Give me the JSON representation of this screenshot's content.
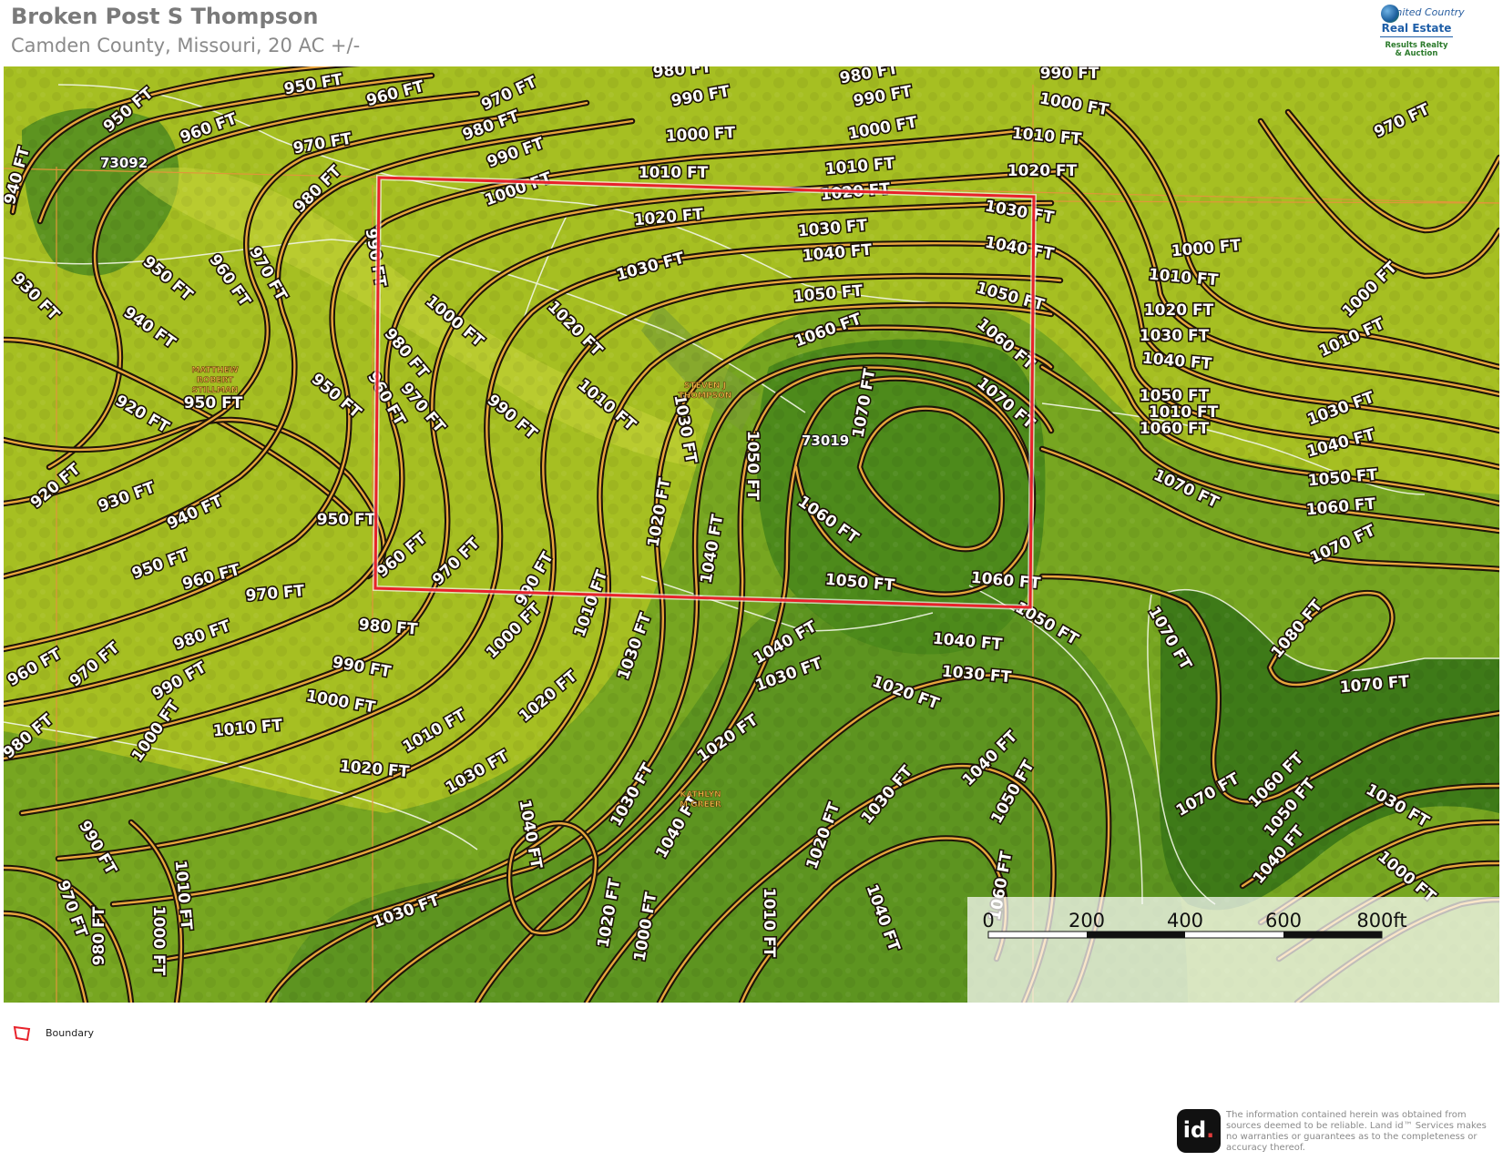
{
  "header": {
    "title": "Broken Post S Thompson",
    "subtitle": "Camden County, Missouri, 20 AC +/-"
  },
  "logo": {
    "line1": "United Country",
    "line2": "Real Estate",
    "line3": "Results Realty",
    "line4": "& Auction"
  },
  "map": {
    "parcels": [
      {
        "id": "73092"
      },
      {
        "id": "73019"
      }
    ],
    "owners": [
      {
        "lines": [
          "MATTHEW",
          "ROBERT",
          "STILLMAN"
        ]
      },
      {
        "lines": [
          "STEVEN J",
          "THOMPSON"
        ]
      },
      {
        "lines": [
          "KATHLYN",
          "M GREER"
        ]
      }
    ],
    "scale": {
      "labels": [
        "0",
        "200",
        "400",
        "600",
        "800ft"
      ]
    },
    "boundary_color": "#e8222b",
    "contour_color": "#e9a63d",
    "terrain_colors": {
      "light": "#a6bf22",
      "dark": "#4f8a1c"
    }
  },
  "legend": {
    "boundary_label": "Boundary"
  },
  "footer": {
    "brand": "id",
    "disclaimer": "The information contained herein was obtained from sources deemed to be reliable. Land id™ Services makes no warranties or guarantees as to the completeness or accuracy thereof."
  }
}
